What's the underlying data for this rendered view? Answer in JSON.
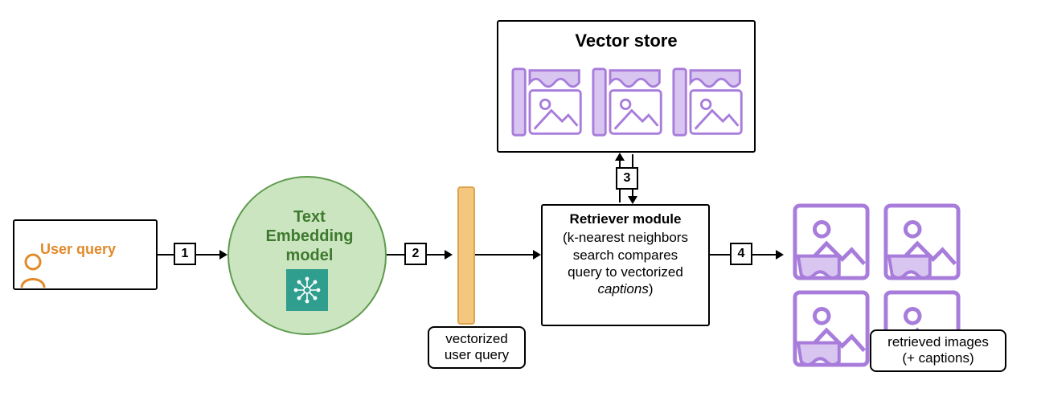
{
  "user_query": {
    "label": "User query"
  },
  "steps": {
    "s1": "1",
    "s2": "2",
    "s3": "3",
    "s4": "4"
  },
  "embedding": {
    "line1": "Text",
    "line2": "Embedding",
    "line3": "model"
  },
  "vec_query": {
    "line1": "vectorized",
    "line2": "user query"
  },
  "vector_store": {
    "title": "Vector store"
  },
  "retriever": {
    "title": "Retriever module",
    "body1": "(k-nearest neighbors",
    "body2": "search compares",
    "body3": "query to vectorized",
    "body4_italic": "captions",
    "body4_tail": ")"
  },
  "output": {
    "line1": "retrieved images",
    "line2": "(+ captions)"
  },
  "colors": {
    "orange": "#e28a2b",
    "green_fill": "#cce5c1",
    "green_stroke": "#5d9b4c",
    "green_text": "#3d7a2e",
    "teal": "#2f9e8f",
    "purple": "#a77cdb",
    "purple_light": "#d8c6f0",
    "vec_fill": "#f4c77f",
    "vec_stroke": "#e0a24d"
  }
}
